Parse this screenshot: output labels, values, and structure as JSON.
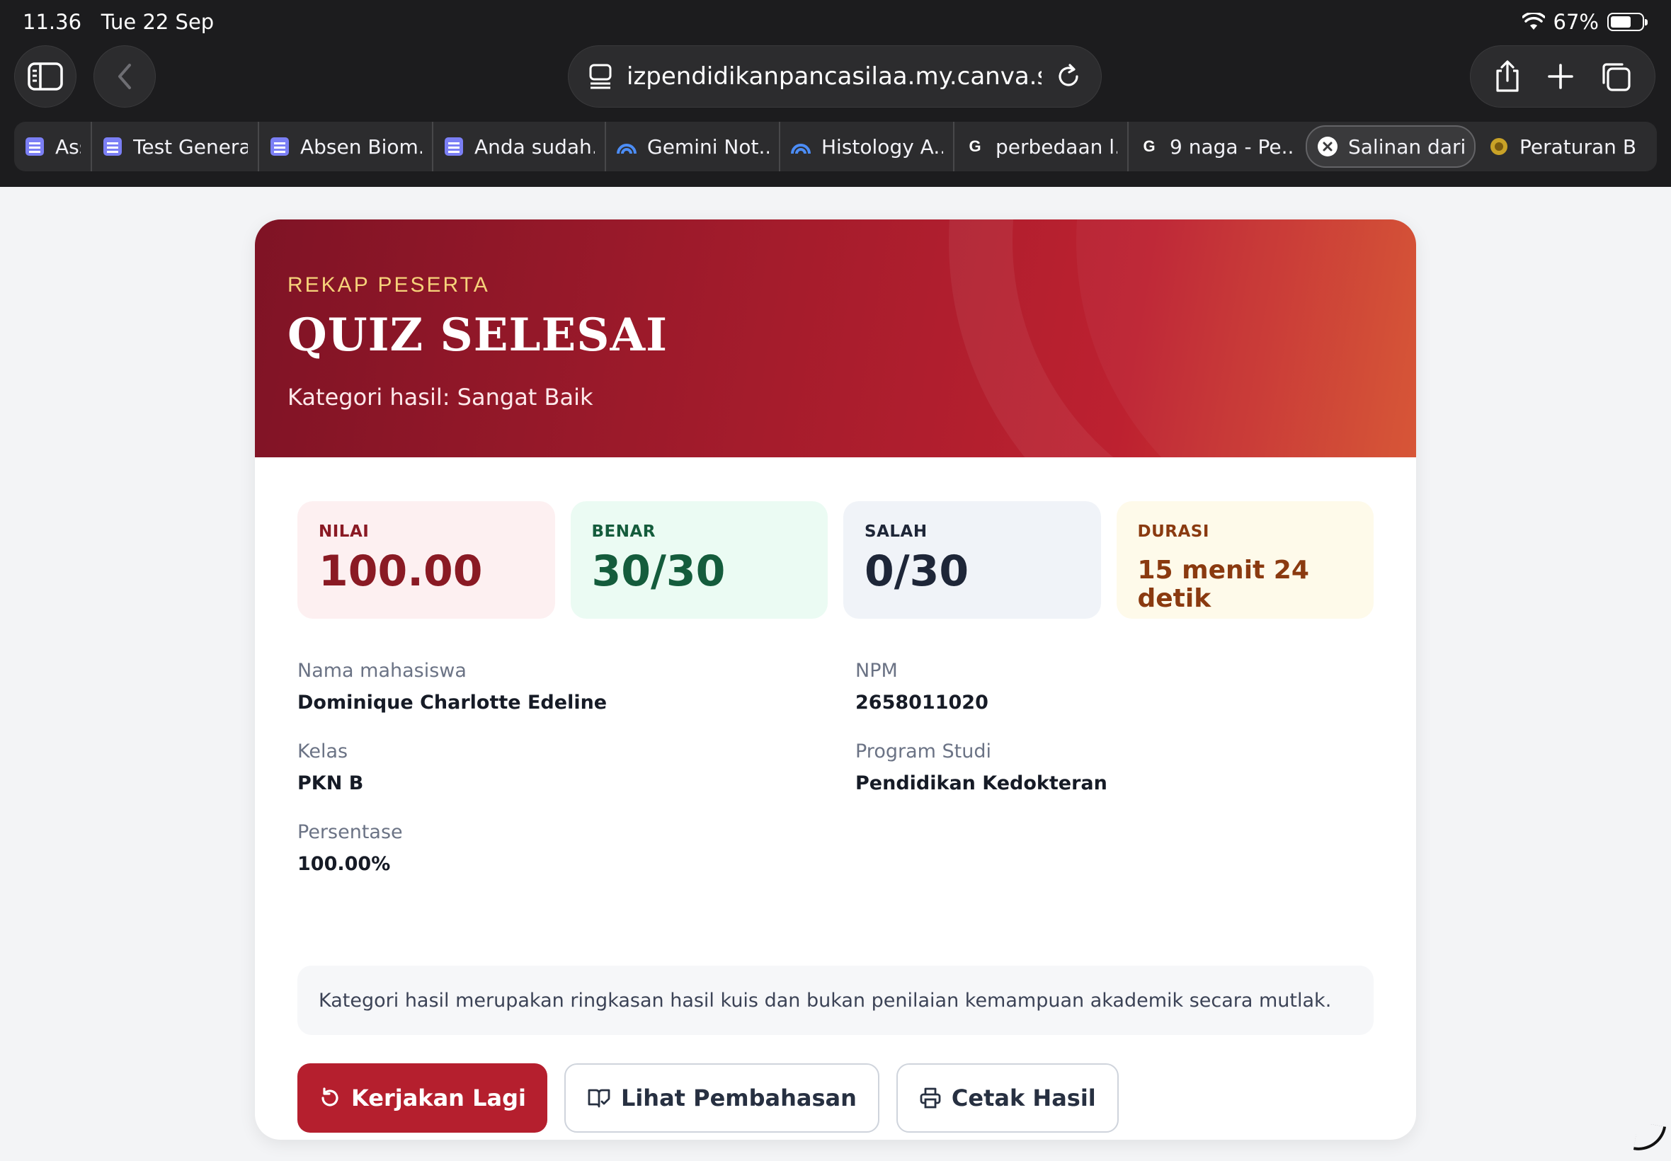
{
  "status_bar": {
    "time": "11.36",
    "date": "Tue 22 Sep",
    "battery": "67%",
    "battery_level": 0.67
  },
  "browser": {
    "url": "izpendidikanpancasilaa.my.canva.site",
    "tabs": [
      {
        "label": "Ass",
        "icon": "forms-icon"
      },
      {
        "label": "Test Genera...",
        "icon": "forms-icon"
      },
      {
        "label": "Absen Biom...",
        "icon": "forms-icon"
      },
      {
        "label": "Anda sudah...",
        "icon": "forms-icon"
      },
      {
        "label": "Gemini Not...",
        "icon": "gemini-icon"
      },
      {
        "label": "Histology A...",
        "icon": "gemini-icon"
      },
      {
        "label": "perbedaan l...",
        "icon": "google-icon"
      },
      {
        "label": "9 naga - Pe...",
        "icon": "google-icon"
      },
      {
        "label": "Salinan dari...",
        "icon": "close-icon",
        "active": true
      },
      {
        "label": "Peraturan B...",
        "icon": "emblem-icon"
      }
    ]
  },
  "hero": {
    "eyebrow": "REKAP PESERTA",
    "title": "QUIZ SELESAI",
    "subtitle": "Kategori hasil: Sangat Baik"
  },
  "stats": {
    "nilai": {
      "label": "NILAI",
      "value": "100.00"
    },
    "benar": {
      "label": "BENAR",
      "value": "30/30"
    },
    "salah": {
      "label": "SALAH",
      "value": "0/30"
    },
    "durasi": {
      "label": "DURASI",
      "value": "15 menit 24 detik"
    }
  },
  "info": {
    "nama": {
      "label": "Nama mahasiswa",
      "value": "Dominique Charlotte Edeline"
    },
    "npm": {
      "label": "NPM",
      "value": "2658011020"
    },
    "kelas": {
      "label": "Kelas",
      "value": "PKN B"
    },
    "prodi": {
      "label": "Program Studi",
      "value": "Pendidikan Kedokteran"
    },
    "persentase": {
      "label": "Persentase",
      "value": "100.00%"
    }
  },
  "note": "Kategori hasil merupakan ringkasan hasil kuis dan bukan penilaian kemampuan akademik secara mutlak.",
  "actions": {
    "retry": "Kerjakan Lagi",
    "review": "Lihat Pembahasan",
    "print": "Cetak Hasil"
  },
  "colors": {
    "primary": "#b51f2e",
    "hero_start": "#7f1325",
    "hero_end": "#d6502f",
    "accent_gold": "#f6d27a"
  }
}
